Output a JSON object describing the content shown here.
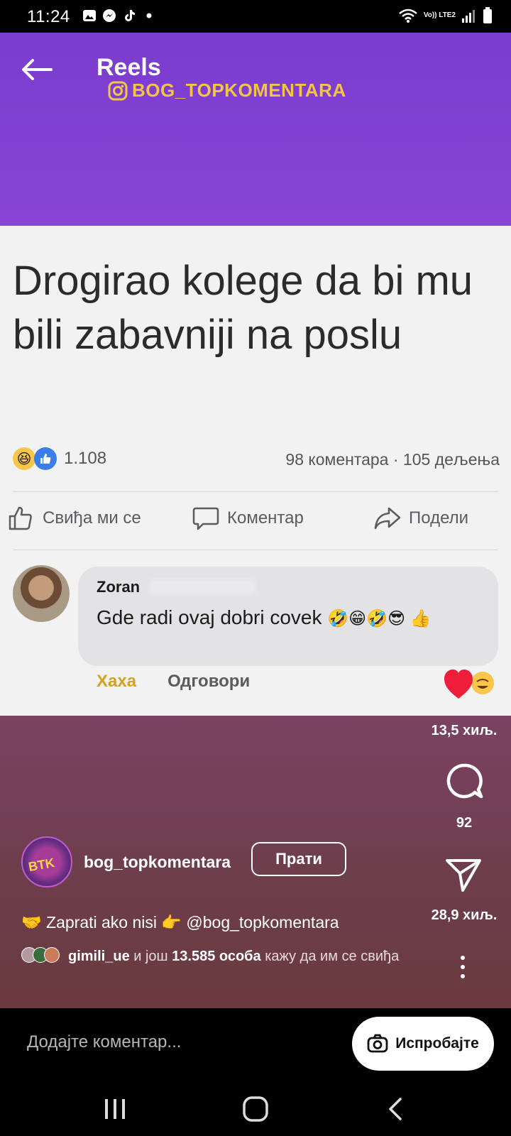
{
  "status_bar": {
    "time": "11:24",
    "notifications": [
      "gallery-icon",
      "messenger-icon",
      "tiktok-icon",
      "dot-icon"
    ],
    "network": "Vo)) LTE2"
  },
  "header": {
    "title": "Reels",
    "watermark": "BOG_TOPKOMENTARA"
  },
  "post": {
    "headline": "Drogirao kolege da bi mu bili zabavniji na poslu",
    "reaction_count": "1.108",
    "comment_stats": "98 коментара · 105 дељења",
    "actions": {
      "like": "Свиђа ми се",
      "comment": "Коментар",
      "share": "Подели"
    },
    "comment": {
      "author": "Zoran",
      "text": "Gde radi ovaj dobri covek",
      "emojis": "🤣😁🤣😎 👍",
      "haha": "Хаха",
      "reply": "Одговори"
    }
  },
  "sidebar": {
    "likes_count": "13,5 хиљ.",
    "comments_count": "92",
    "shares_count": "28,9 хиљ."
  },
  "reel": {
    "username": "bog_topkomentara",
    "avatar_text": "BTK",
    "follow_label": "Прати",
    "caption": "🤝 Zaprati ako nisi 👉 @bog_topkomentara",
    "liked_by_user": "gimili_ue",
    "liked_by_mid": " и још ",
    "liked_by_count": "13.585 особа",
    "liked_by_suffix": " кажу да им се свиђа"
  },
  "comment_bar": {
    "placeholder": "Додајте коментар...",
    "try_label": "Испробајте"
  },
  "colors": {
    "header_purple": "#8845d6",
    "watermark_gold": "#f2c542",
    "haha_gold": "#d4a21f",
    "heart_red": "#ee1d3a",
    "overlay_maroon": "#6d3e4b"
  }
}
